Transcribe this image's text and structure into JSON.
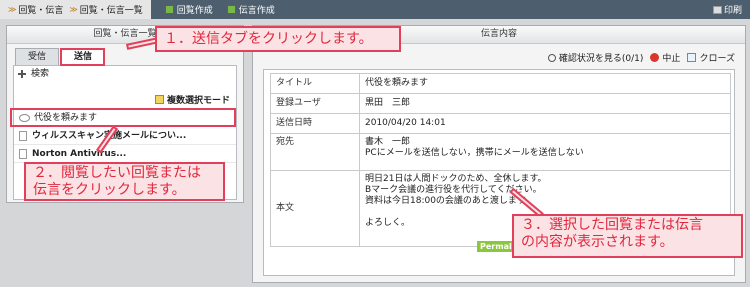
{
  "topbar": {
    "crumb1": "回覧・伝言",
    "crumb2": "回覧・伝言一覧",
    "btn_circular": "回覧作成",
    "btn_message": "伝言作成",
    "print": "印刷"
  },
  "left": {
    "title": "回覧・伝言一覧",
    "tabs": [
      "受信",
      "送信"
    ],
    "search": "検索",
    "multiselect": "複数選択モード",
    "items": [
      "代役を頼みます",
      "ウィルススキャン実施メールについ...",
      "Norton Antivirus..."
    ]
  },
  "right": {
    "title": "伝言内容",
    "actions": {
      "status": "確認状況を見る(0/1)",
      "stop": "中止",
      "close": "クローズ"
    },
    "rows": [
      {
        "key": "タイトル",
        "value": "代役を頼みます"
      },
      {
        "key": "登録ユーザ",
        "value": "黒田　三郎"
      },
      {
        "key": "送信日時",
        "value": "2010/04/20 14:01"
      },
      {
        "key": "宛先",
        "value": "書木　一郎",
        "value2": "PCにメールを送信しない，携帯にメールを送信しない"
      },
      {
        "key": "本文",
        "lines": [
          "明日21日は人間ドックのため、全休します。",
          "Bマーク会議の進行役を代行してください。",
          "資料は今日18:00の会議のあと渡します。",
          "",
          "よろしく。"
        ]
      }
    ],
    "permalink": "Permalink"
  },
  "callouts": {
    "c1": "１．送信タブをクリックします。",
    "c2_line1": "２．閲覧したい回覧または",
    "c2_line2": "伝言をクリックします。",
    "c3_line1": "３．選択した回覧または伝言",
    "c3_line2": "の内容が表示されます。"
  }
}
